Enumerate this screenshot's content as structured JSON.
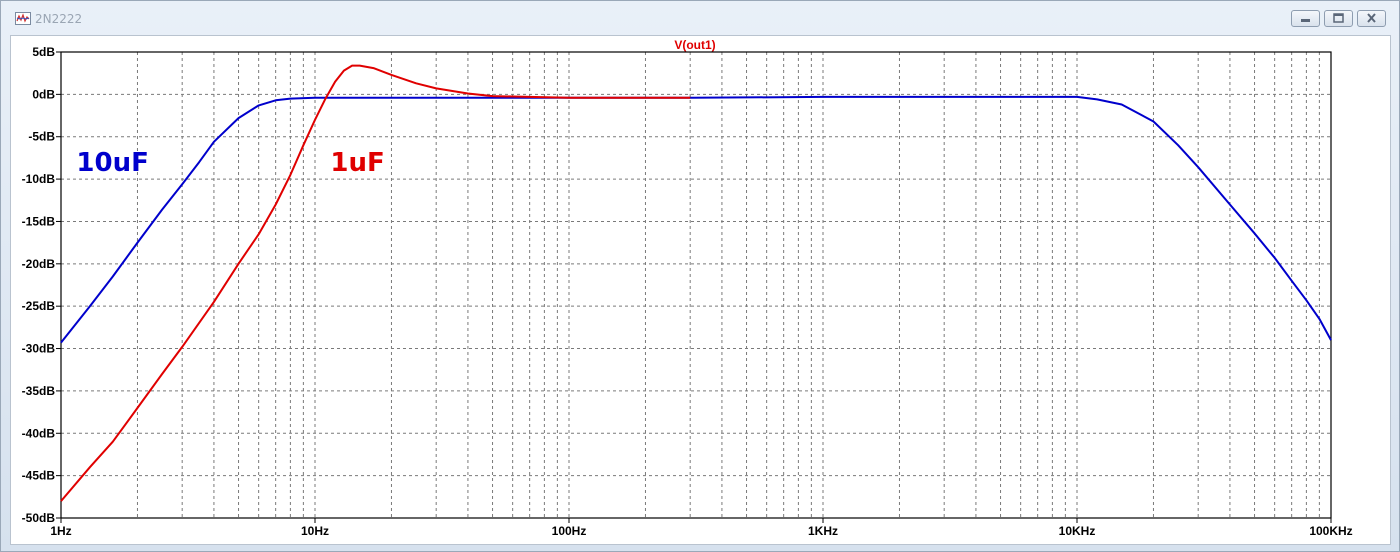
{
  "window": {
    "title": "2N2222",
    "icon": "waveform-plot-icon",
    "buttons": [
      "minimize",
      "restore",
      "close"
    ]
  },
  "chart_data": {
    "type": "line",
    "title": "V(out1)",
    "title_color": "#e00000",
    "x_scale": "log",
    "xlim": [
      1,
      100000
    ],
    "ylim": [
      -50,
      5
    ],
    "x_ticks": [
      {
        "value": 1,
        "label": "1Hz"
      },
      {
        "value": 10,
        "label": "10Hz"
      },
      {
        "value": 100,
        "label": "100Hz"
      },
      {
        "value": 1000,
        "label": "1KHz"
      },
      {
        "value": 10000,
        "label": "10KHz"
      },
      {
        "value": 100000,
        "label": "100KHz"
      }
    ],
    "y_ticks": [
      {
        "value": 5,
        "label": "5dB"
      },
      {
        "value": 0,
        "label": "0dB"
      },
      {
        "value": -5,
        "label": "-5dB"
      },
      {
        "value": -10,
        "label": "-10dB"
      },
      {
        "value": -15,
        "label": "-15dB"
      },
      {
        "value": -20,
        "label": "-20dB"
      },
      {
        "value": -25,
        "label": "-25dB"
      },
      {
        "value": -30,
        "label": "-30dB"
      },
      {
        "value": -35,
        "label": "-35dB"
      },
      {
        "value": -40,
        "label": "-40dB"
      },
      {
        "value": -45,
        "label": "-45dB"
      },
      {
        "value": -50,
        "label": "-50dB"
      }
    ],
    "grid": true,
    "series": [
      {
        "name": "10uF",
        "color": "#0000cc",
        "points": [
          [
            1,
            -29.3
          ],
          [
            1.3,
            -25
          ],
          [
            1.6,
            -21.5
          ],
          [
            2,
            -17.5
          ],
          [
            2.5,
            -13.6
          ],
          [
            3,
            -10.6
          ],
          [
            3.5,
            -8
          ],
          [
            4,
            -5.6
          ],
          [
            5,
            -2.8
          ],
          [
            6,
            -1.3
          ],
          [
            7,
            -0.7
          ],
          [
            8,
            -0.5
          ],
          [
            10,
            -0.4
          ],
          [
            20,
            -0.4
          ],
          [
            100,
            -0.4
          ],
          [
            300,
            -0.4
          ],
          [
            1000,
            -0.3
          ],
          [
            5000,
            -0.3
          ],
          [
            10000,
            -0.3
          ],
          [
            12000,
            -0.6
          ],
          [
            15000,
            -1.2
          ],
          [
            20000,
            -3.2
          ],
          [
            25000,
            -6
          ],
          [
            30000,
            -8.6
          ],
          [
            40000,
            -13
          ],
          [
            50000,
            -16.4
          ],
          [
            60000,
            -19.3
          ],
          [
            70000,
            -22
          ],
          [
            80000,
            -24.3
          ],
          [
            90000,
            -26.5
          ],
          [
            100000,
            -29
          ]
        ]
      },
      {
        "name": "1uF",
        "color": "#e00000",
        "points": [
          [
            1,
            -48
          ],
          [
            1.3,
            -44
          ],
          [
            1.6,
            -41
          ],
          [
            2,
            -37
          ],
          [
            2.5,
            -33
          ],
          [
            3,
            -29.8
          ],
          [
            4,
            -24.5
          ],
          [
            5,
            -20
          ],
          [
            6,
            -16.5
          ],
          [
            7,
            -13
          ],
          [
            8,
            -9.5
          ],
          [
            9,
            -6
          ],
          [
            10,
            -3
          ],
          [
            11,
            -0.5
          ],
          [
            12,
            1.5
          ],
          [
            13,
            2.8
          ],
          [
            14,
            3.4
          ],
          [
            15,
            3.4
          ],
          [
            17,
            3.1
          ],
          [
            20,
            2.3
          ],
          [
            25,
            1.3
          ],
          [
            30,
            0.7
          ],
          [
            40,
            0.1
          ],
          [
            50,
            -0.2
          ],
          [
            70,
            -0.3
          ],
          [
            100,
            -0.4
          ],
          [
            200,
            -0.4
          ],
          [
            300,
            -0.4
          ]
        ]
      }
    ],
    "annotations": [
      {
        "text": "10uF",
        "color": "#0000cc",
        "at": [
          1.15,
          -8
        ]
      },
      {
        "text": "1uF",
        "color": "#e00000",
        "at": [
          11.5,
          -8
        ]
      }
    ]
  }
}
